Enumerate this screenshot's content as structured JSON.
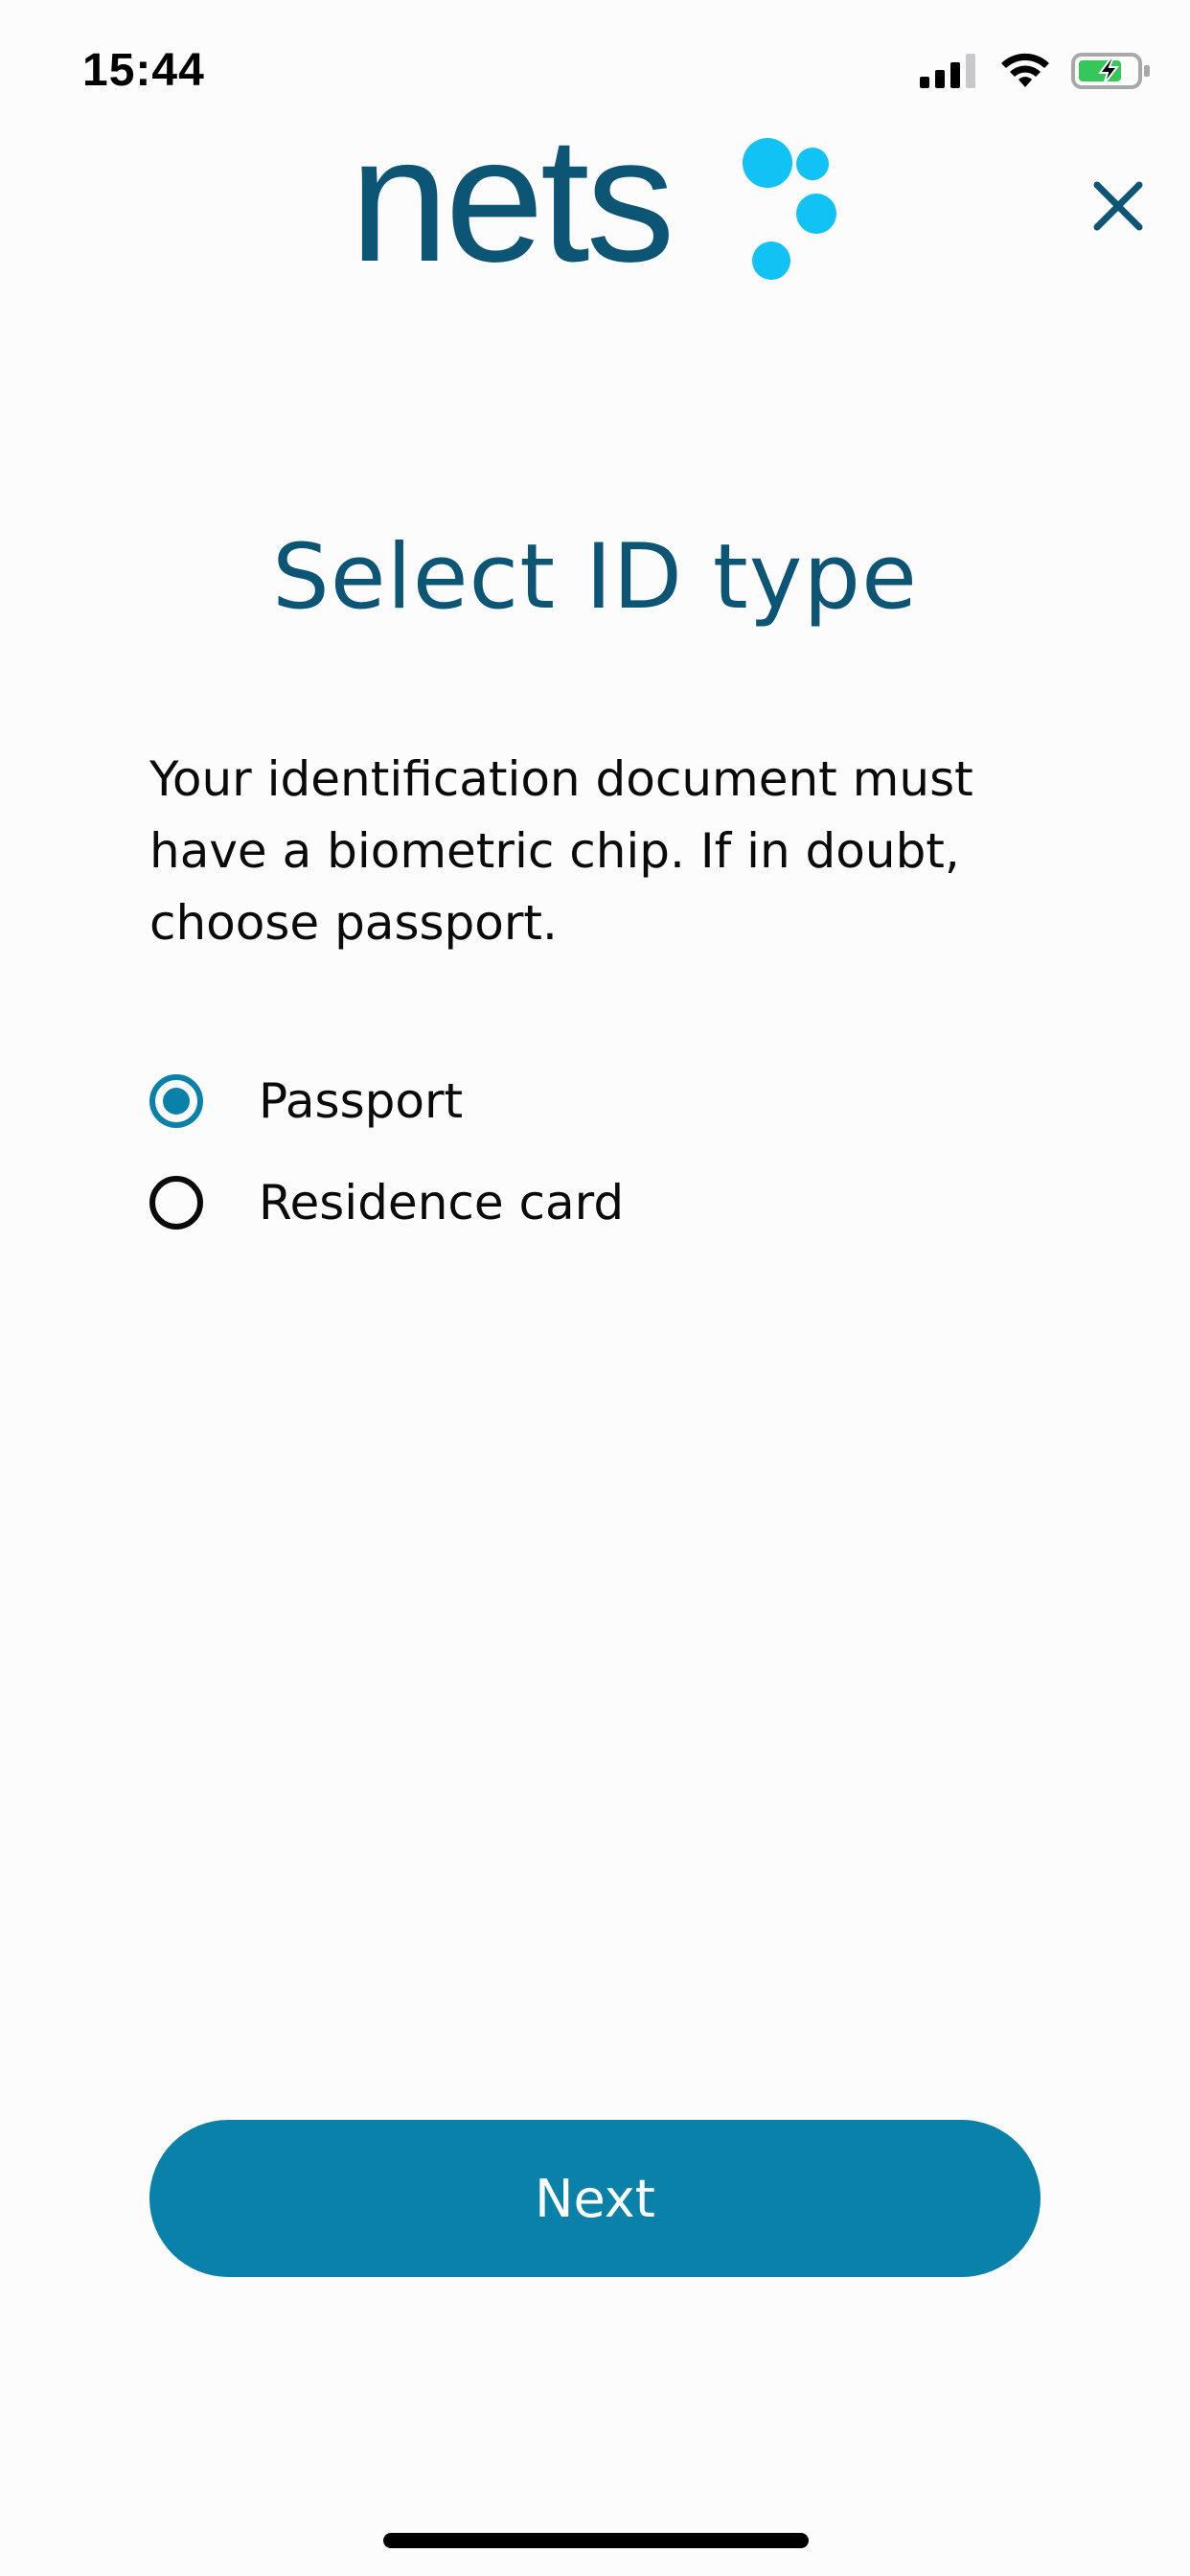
{
  "status_bar": {
    "time": "15:44"
  },
  "brand": {
    "logo_text": "nets",
    "primary_color": "#0d5575",
    "accent_color": "#10c3f4"
  },
  "header": {
    "close_icon": "close-icon"
  },
  "main": {
    "title": "Select ID type",
    "description": "Your identification document must have a biometric chip. If in doubt, choose passport.",
    "options": [
      {
        "label": "Passport",
        "selected": true
      },
      {
        "label": "Residence card",
        "selected": false
      }
    ]
  },
  "footer": {
    "next_label": "Next",
    "button_color": "#0a81a8"
  }
}
